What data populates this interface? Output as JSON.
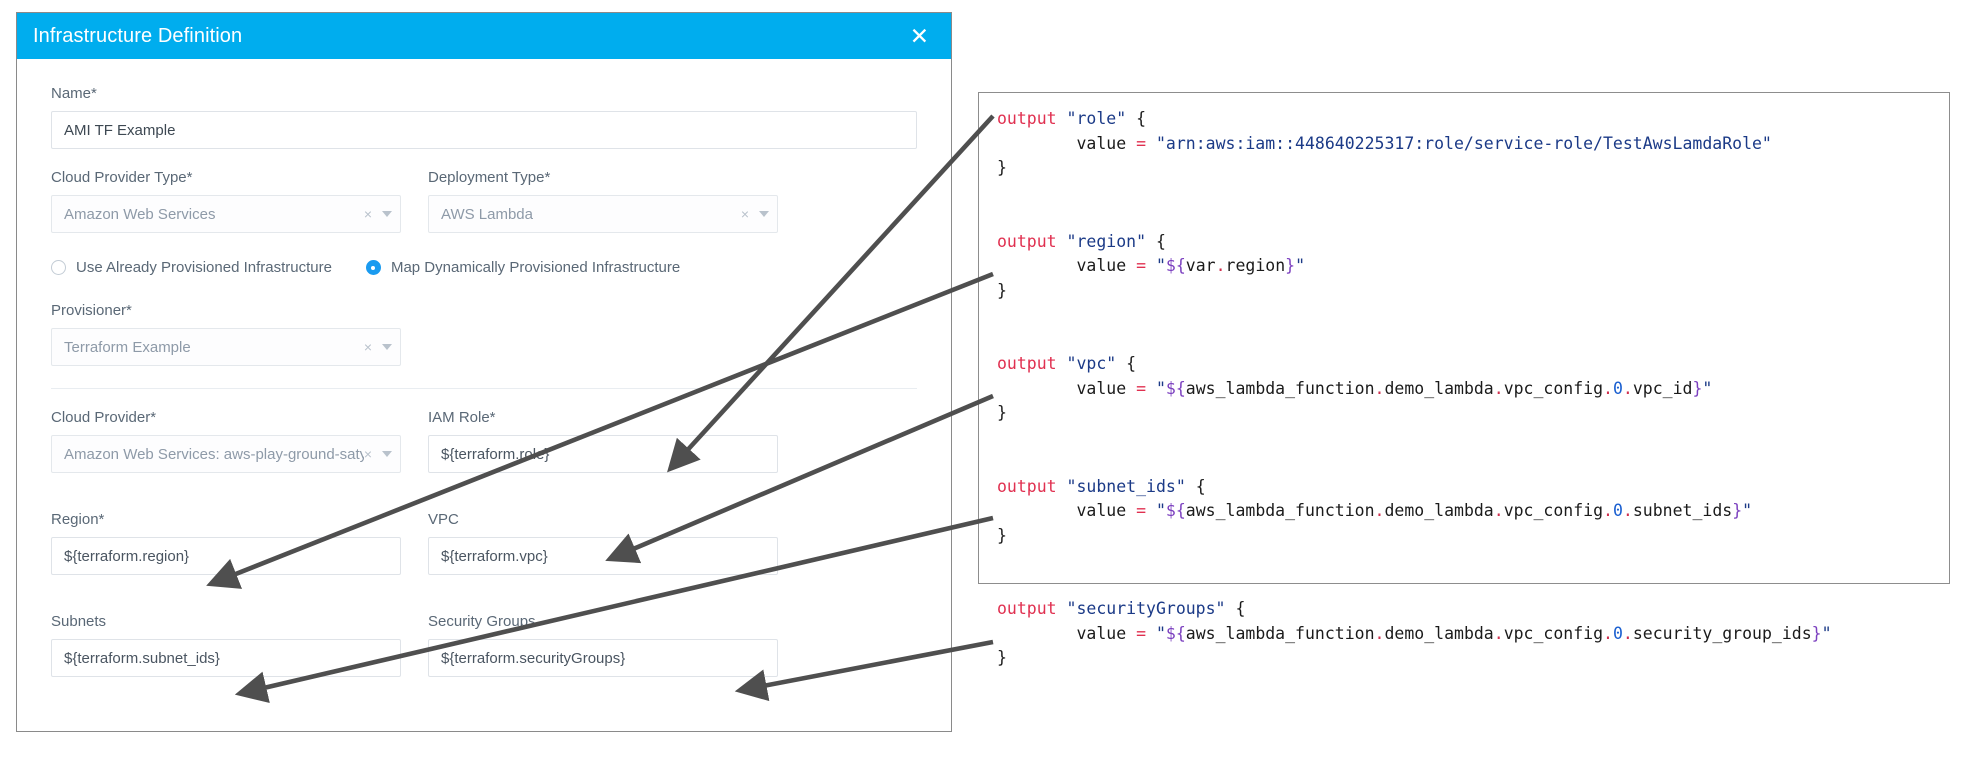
{
  "dialog": {
    "title": "Infrastructure Definition",
    "close_icon": "close-x-icon",
    "header_color": "#00ADEE",
    "fields": {
      "name": {
        "label": "Name*",
        "value": "AMI TF Example"
      },
      "cloud_provider_type": {
        "label": "Cloud Provider Type*",
        "value": "Amazon Web Services",
        "clear": "×"
      },
      "deployment_type": {
        "label": "Deployment Type*",
        "value": "AWS Lambda",
        "clear": "×"
      },
      "provisioner": {
        "label": "Provisioner*",
        "value": "Terraform Example",
        "clear": "×"
      },
      "cloud_provider": {
        "label": "Cloud Provider*",
        "value": "Amazon Web Services: aws-play-ground-satyam",
        "clear": "×"
      },
      "iam_role": {
        "label": "IAM Role*",
        "value": "${terraform.role}"
      },
      "region": {
        "label": "Region*",
        "value": "${terraform.region}"
      },
      "vpc": {
        "label": "VPC",
        "value": "${terraform.vpc}"
      },
      "subnets": {
        "label": "Subnets",
        "value": "${terraform.subnet_ids}"
      },
      "security_groups": {
        "label": "Security Groups",
        "value": "${terraform.securityGroups}"
      }
    },
    "radios": [
      {
        "label": "Use Already Provisioned Infrastructure",
        "selected": false
      },
      {
        "label": "Map Dynamically Provisioned Infrastructure",
        "selected": true
      }
    ]
  },
  "code_panel": {
    "blocks": [
      {
        "name": "role",
        "open": "output \"role\" {",
        "value_line": "value = \"arn:aws:iam::448640225317:role/service-role/TestAwsLamdaRole\"",
        "close": "}",
        "value_literal": "arn:aws:iam::448640225317:role/service-role/TestAwsLamdaRole",
        "interpolated": false
      },
      {
        "name": "region",
        "open": "output \"region\" {",
        "value_line": "value = \"${var.region}\"",
        "close": "}",
        "value_literal": "${var.region}",
        "interpolated": true,
        "path_parts": [
          "var",
          "region"
        ]
      },
      {
        "name": "vpc",
        "open": "output \"vpc\" {",
        "value_line": "value = \"${aws_lambda_function.demo_lambda.vpc_config.0.vpc_id}\"",
        "close": "}",
        "value_literal": "${aws_lambda_function.demo_lambda.vpc_config.0.vpc_id}",
        "interpolated": true,
        "path_parts": [
          "aws_lambda_function",
          "demo_lambda",
          "vpc_config",
          "0",
          "vpc_id"
        ]
      },
      {
        "name": "subnet_ids",
        "open": "output \"subnet_ids\" {",
        "value_line": "value = \"${aws_lambda_function.demo_lambda.vpc_config.0.subnet_ids}\"",
        "close": "}",
        "value_literal": "${aws_lambda_function.demo_lambda.vpc_config.0.subnet_ids}",
        "interpolated": true,
        "path_parts": [
          "aws_lambda_function",
          "demo_lambda",
          "vpc_config",
          "0",
          "subnet_ids"
        ]
      },
      {
        "name": "securityGroups",
        "open": "output \"securityGroups\" {",
        "value_line": "value = \"${aws_lambda_function.demo_lambda.vpc_config.0.security_group_ids}\"",
        "close": "}",
        "value_literal": "${aws_lambda_function.demo_lambda.vpc_config.0.security_group_ids}",
        "interpolated": true,
        "path_parts": [
          "aws_lambda_function",
          "demo_lambda",
          "vpc_config",
          "0",
          "security_group_ids"
        ]
      }
    ],
    "keyword": "output",
    "assign_keyword": "value",
    "colors": {
      "keyword": "#e03050",
      "string": "#1b3a87",
      "interpolation": "#7b3fbf",
      "number": "#1a5fd0",
      "punct": "#d02f4e"
    }
  },
  "annotations": {
    "arrow_color": "#4f4f4f",
    "mappings": [
      {
        "from_output": "role",
        "to_field": "iam_role"
      },
      {
        "from_output": "region",
        "to_field": "region"
      },
      {
        "from_output": "vpc",
        "to_field": "vpc"
      },
      {
        "from_output": "subnet_ids",
        "to_field": "subnets"
      },
      {
        "from_output": "securityGroups",
        "to_field": "security_groups"
      }
    ]
  }
}
